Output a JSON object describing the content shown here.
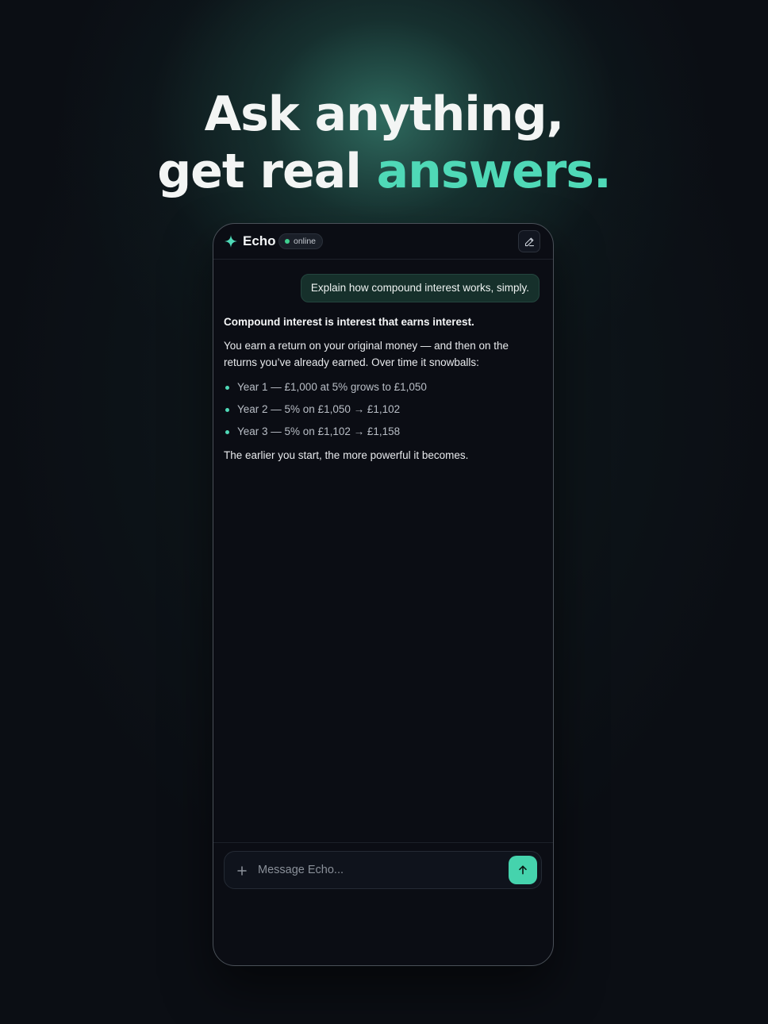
{
  "hero": {
    "line1": "Ask anything,",
    "line2_prefix": "get real ",
    "line2_accent": "answers."
  },
  "app": {
    "name": "Echo",
    "status": "online",
    "icons": {
      "brand": "sparkle-icon",
      "new_chat": "edit-pencil-icon",
      "attach": "plus-icon",
      "send": "arrow-up-icon"
    }
  },
  "conversation": {
    "user_message": "Explain how compound interest works, simply.",
    "assistant": {
      "lead": "Compound interest is interest that earns interest.",
      "paragraph": "You earn a return on your original money — and then on the returns you’ve already earned. Over time it snowballs:",
      "bullets": [
        "Year 1 — £1,000 at 5% grows to £1,050",
        "Year 2 — 5% on £1,050 → £1,102",
        "Year 3 — 5% on £1,102 → £1,158"
      ],
      "closing": "The earlier you start, the more powerful it becomes."
    }
  },
  "composer": {
    "placeholder": "Message Echo...",
    "value": ""
  },
  "colors": {
    "accent": "#4fd9b7",
    "send_button": "#45d3ad",
    "status_dot": "#3fd08f",
    "background": "#0b0e14"
  }
}
